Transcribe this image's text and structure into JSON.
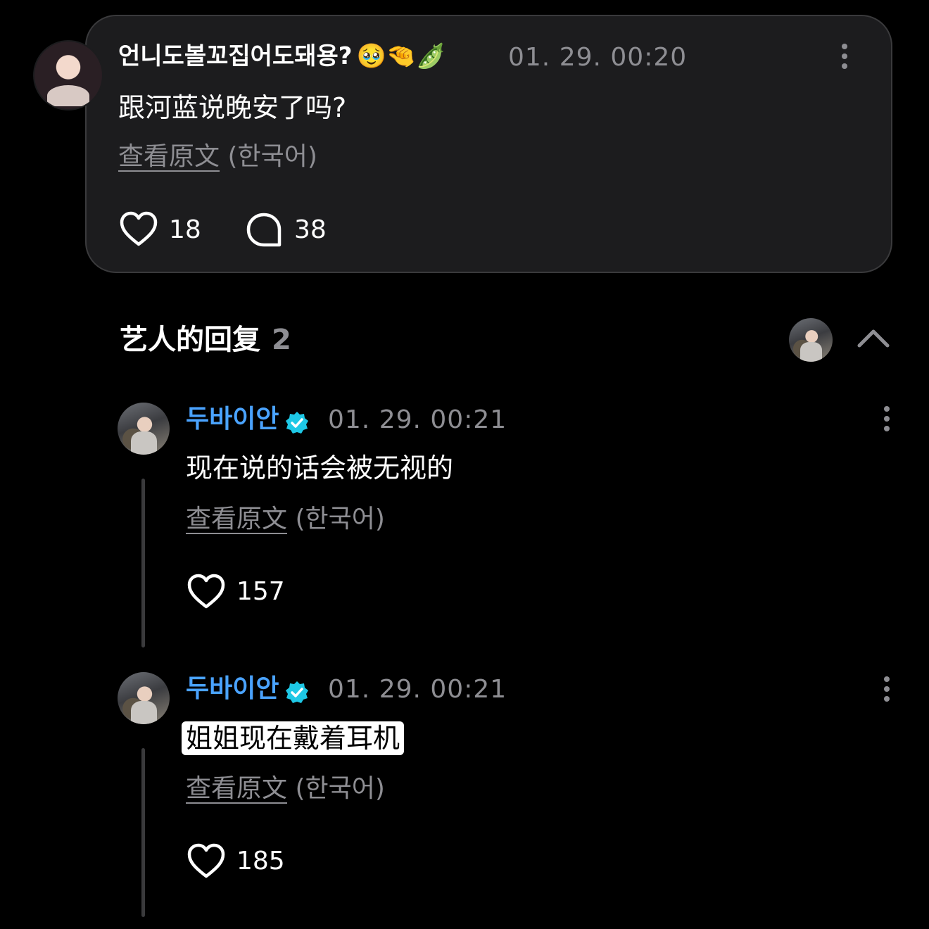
{
  "post": {
    "username": "언니도볼꼬집어도돼용?",
    "emojis": "🥹🤏🫛",
    "timestamp": "01. 29. 00:20",
    "text": "跟河蓝说晚安了吗?",
    "translate_label": "查看原文",
    "translate_lang": "(한국어)",
    "likes": "18",
    "comments": "38"
  },
  "replies_section": {
    "title": "艺人的回复",
    "count": "2"
  },
  "replies": [
    {
      "username": "두바이안",
      "timestamp": "01. 29. 00:21",
      "text": "现在说的话会被无视的",
      "translate_label": "查看原文",
      "translate_lang": "(한국어)",
      "likes": "157"
    },
    {
      "username": "두바이안",
      "timestamp": "01. 29. 00:21",
      "text": "姐姐现在戴着耳机",
      "translate_label": "查看原文",
      "translate_lang": "(한국어)",
      "likes": "185"
    }
  ],
  "icons": {
    "like": "heart-outline-icon",
    "comment": "speech-bubble-icon",
    "more": "vertical-dots-icon",
    "collapse": "chevron-up-icon",
    "verified": "verified-badge-icon"
  },
  "colors": {
    "background": "#000000",
    "card": "#1c1c1e",
    "artist_name": "#4aa3ff",
    "verified_badge": "#1ec8e6",
    "muted_text": "#8e8e93"
  }
}
